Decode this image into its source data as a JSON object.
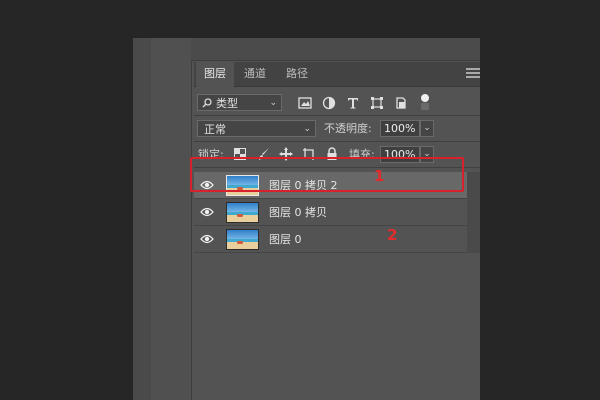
{
  "layers_panel": {
    "tabs": [
      {
        "label": "图层"
      },
      {
        "label": "通道"
      },
      {
        "label": "路径"
      }
    ],
    "filter": {
      "kind_value": "类型"
    },
    "blend_mode": {
      "value": "正常"
    },
    "opacity": {
      "label": "不透明度:",
      "value": "100%"
    },
    "lock": {
      "label": "锁定:"
    },
    "fill": {
      "label": "填充:",
      "value": "100%"
    },
    "layers": [
      {
        "name": "图层 0 拷贝 2",
        "selected": true,
        "visible": true
      },
      {
        "name": "图层 0 拷贝",
        "selected": false,
        "visible": true
      },
      {
        "name": "图层 0",
        "selected": false,
        "visible": true
      }
    ]
  },
  "annotations": {
    "marker_1": "1",
    "marker_2": "2",
    "color": "#d8212a"
  },
  "colors": {
    "panel_bg": "#535353",
    "selected_row_bg": "#686868",
    "background": "#262626"
  }
}
